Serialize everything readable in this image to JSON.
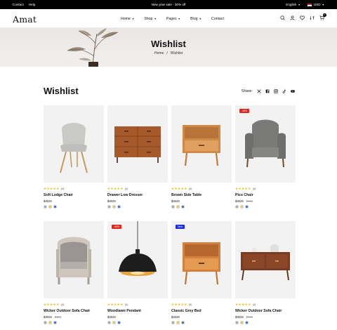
{
  "topbar": {
    "links": [
      "Contact",
      "Help"
    ],
    "promo": "New year sale - 30% off",
    "language": "English",
    "currency": "USD"
  },
  "header": {
    "logo": "Amat",
    "nav": [
      "Home",
      "Shop",
      "Pages",
      "Blog",
      "Contact"
    ],
    "cart_count": "0"
  },
  "banner": {
    "title": "Wishlist",
    "breadcrumb": [
      "Home",
      "Wishlist"
    ]
  },
  "wishlist": {
    "title": "Wishlist",
    "share_label": "Share:",
    "share_icons": [
      "x-icon",
      "facebook-icon",
      "instagram-icon",
      "tiktok-icon",
      "youtube-icon"
    ]
  },
  "colors": {
    "badge_sale": "#e0251b",
    "badge_new": "#1a2ee0",
    "star": "#f4b400",
    "swatch_grey": "#a9a9a9",
    "swatch_yellow": "#f2c94c",
    "swatch_blue": "#2d6cdf"
  },
  "products": [
    {
      "name": "Soft Lodge Chair",
      "rating": 5,
      "reviews": "(4)",
      "price": "$3029",
      "old_price": "",
      "badge": ""
    },
    {
      "name": "Drawer Low Dresser",
      "rating": 5,
      "reviews": "(4)",
      "price": "$3029",
      "old_price": "",
      "badge": ""
    },
    {
      "name": "Brown Side Table",
      "rating": 5,
      "reviews": "(4)",
      "price": "$3029",
      "old_price": "",
      "badge": ""
    },
    {
      "name": "Pico Chair",
      "rating": 5,
      "reviews": "(4)",
      "price": "$3029",
      "old_price": "$404",
      "badge": "-44%"
    },
    {
      "name": "Wicker Outdoor Sofa Chair",
      "rating": 5,
      "reviews": "(4)",
      "price": "$3029",
      "old_price": "$404",
      "badge": ""
    },
    {
      "name": "Woodlawn Pendant",
      "rating": 5,
      "reviews": "(4)",
      "price": "$3029",
      "old_price": "",
      "badge": "-44%"
    },
    {
      "name": "Classic Grey Bed",
      "rating": 5,
      "reviews": "(4)",
      "price": "$3029",
      "old_price": "",
      "badge": "New"
    },
    {
      "name": "Wicker Outdoor Sofa Chair",
      "rating": 5,
      "reviews": "(4)",
      "price": "$3029",
      "old_price": "$404",
      "badge": ""
    }
  ]
}
